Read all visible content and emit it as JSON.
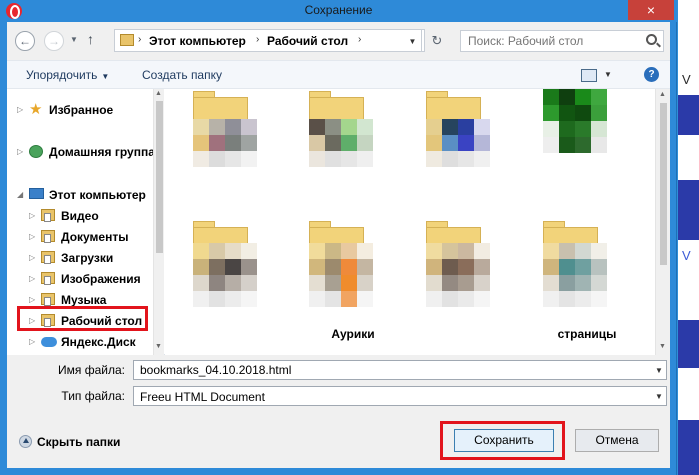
{
  "window": {
    "title": "Сохранение",
    "close_glyph": "×"
  },
  "nav": {
    "back_glyph": "←",
    "forward_glyph": "→",
    "up_glyph": "↑",
    "breadcrumb": [
      "Этот компьютер",
      "Рабочий стол"
    ],
    "refresh_glyph": "↻",
    "search_placeholder": "Поиск: Рабочий стол"
  },
  "toolbar": {
    "organize_label": "Упорядочить",
    "new_folder_label": "Создать папку",
    "help_glyph": "?"
  },
  "tree": [
    {
      "label": "Избранное",
      "icon": "star-icon"
    },
    {
      "label": "Домашняя группа",
      "icon": "homegroup-icon"
    },
    {
      "label": "Этот компьютер",
      "icon": "computer-icon"
    },
    {
      "label": "Видео",
      "icon": "folder-icon"
    },
    {
      "label": "Документы",
      "icon": "folder-icon"
    },
    {
      "label": "Загрузки",
      "icon": "folder-icon"
    },
    {
      "label": "Изображения",
      "icon": "folder-icon"
    },
    {
      "label": "Музыка",
      "icon": "folder-icon"
    },
    {
      "label": "Рабочий стол",
      "icon": "folder-icon",
      "selected": true
    },
    {
      "label": "Яндекс.Диск",
      "icon": "cloud-icon"
    }
  ],
  "files": [
    {
      "label": ""
    },
    {
      "label": ""
    },
    {
      "label": ""
    },
    {
      "label": ""
    },
    {
      "label": ""
    },
    {
      "label": "Аурики"
    },
    {
      "label": ""
    },
    {
      "label": "страницы"
    }
  ],
  "form": {
    "filename_label": "Имя файла:",
    "filename_value": "bookmarks_04.10.2018.html",
    "filetype_label": "Тип файла:",
    "filetype_value": "Freeu HTML Document"
  },
  "footer": {
    "hide_folders_label": "Скрыть папки",
    "save_label": "Сохранить",
    "cancel_label": "Отмена"
  },
  "colors": {
    "highlight": "#e2141c",
    "titlebar": "#2e8ad8",
    "close": "#c7413a"
  },
  "background_strip": [
    "V",
    "V"
  ]
}
